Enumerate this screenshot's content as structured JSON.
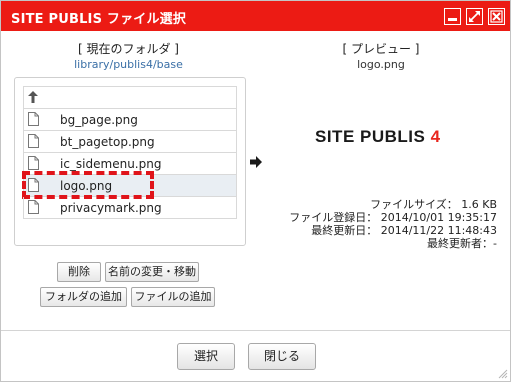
{
  "window": {
    "title": "SITE PUBLIS ファイル選択",
    "accent_color": "#ec1b14",
    "controls": [
      "minimize-icon",
      "maximize-icon",
      "close-icon"
    ]
  },
  "folder": {
    "label": "[ 現在のフォルダ ]",
    "path": "library/publis4/base"
  },
  "preview": {
    "label": "[ プレビュー ]",
    "filename": "logo.png",
    "logo_text": "SITE PUBLIS",
    "logo_number": "4"
  },
  "files": {
    "up_icon": "up-arrow-icon",
    "items": [
      {
        "name": "bg_page.png"
      },
      {
        "name": "bt_pagetop.png"
      },
      {
        "name": "ic_sidemenu.png"
      },
      {
        "name": "logo.png",
        "selected": true
      },
      {
        "name": "privacymark.png"
      }
    ]
  },
  "meta": {
    "size": "ファイルサイズ： 1.6 KB",
    "registered": "ファイル登録日： 2014/10/01 19:35:17",
    "updated": "最終更新日： 2014/11/22 11:48:43",
    "updater": "最終更新者：-"
  },
  "actions": {
    "delete": "削除",
    "rename_move": "名前の変更・移動",
    "add_folder": "フォルダの追加",
    "add_file": "ファイルの追加"
  },
  "footer": {
    "select": "選択",
    "close": "閉じる"
  }
}
